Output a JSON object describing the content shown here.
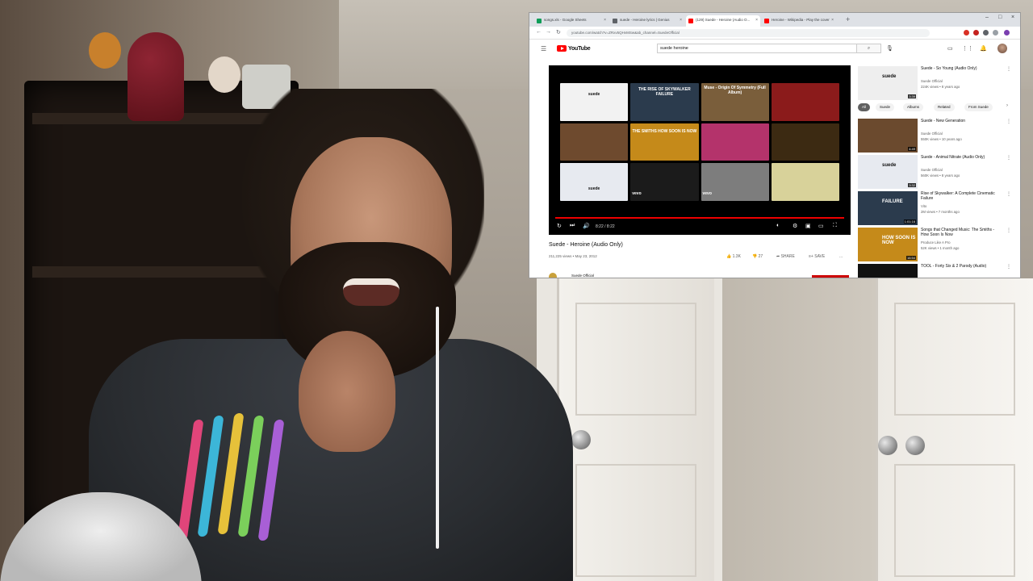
{
  "browser": {
    "tabs": [
      {
        "label": "songs.xls - Google Sheets",
        "color": "#0f9d58"
      },
      {
        "label": "suede - Heroine lyrics | Genius",
        "color": "#5f6368"
      },
      {
        "label": "(129) Suede - Heroine (Audio O...",
        "color": "#ff0000"
      },
      {
        "label": "Heroine - Wikipedia - Play the cover",
        "color": "#ff0000"
      }
    ],
    "new_tab": "+",
    "url": "youtube.com/watch?v=ZRxv5QHvMSw&ab_channel=SuedeOfficial"
  },
  "youtube": {
    "logo": "YouTube",
    "search_query": "suede heroine",
    "player": {
      "time": "8:22 / 8:22",
      "tiles": [
        {
          "text": "suede",
          "bg": "#f2f2f2",
          "fg": "#111"
        },
        {
          "text": "THE RISE OF SKYWALKER FAILURE",
          "bg": "#2b3b4d",
          "fg": "#fff"
        },
        {
          "text": "Muse - Origin Of Symmetry (Full Album)",
          "bg": "#7a5e3b",
          "fg": "#fff"
        },
        {
          "text": "",
          "bg": "#8b1b1b",
          "fg": "#fff"
        },
        {
          "text": "",
          "bg": "#6e4a2e",
          "fg": "#fff"
        },
        {
          "text": "THE SMITHS HOW SOON IS NOW",
          "bg": "#c58a1a",
          "fg": "#fff"
        },
        {
          "text": "",
          "bg": "#b4336b",
          "fg": "#fff"
        },
        {
          "text": "",
          "bg": "#3c2a12",
          "fg": "#fff"
        },
        {
          "text": "suede",
          "bg": "#e7eaf0",
          "fg": "#111"
        },
        {
          "text": "vevo",
          "bg": "#1b1b1b",
          "fg": "#fff"
        },
        {
          "text": "vevo",
          "bg": "#7d7d7d",
          "fg": "#fff"
        },
        {
          "text": "",
          "bg": "#d8d29a",
          "fg": "#333"
        }
      ]
    },
    "video": {
      "title": "Suede - Heroine (Audio Only)",
      "meta": "211,225 views • May 23, 2012",
      "likes": "1.3K",
      "dislikes": "27",
      "share": "SHARE",
      "save": "SAVE",
      "more": "...",
      "channel": "Suede Official"
    },
    "chips": [
      "All",
      "Suede",
      "Albums",
      "Related",
      "From Suede"
    ],
    "recommendations": [
      {
        "title": "Suede - So Young (Audio Only)",
        "channel": "Suede Official",
        "stats": "224K views • 8 years ago",
        "duration": "3:39",
        "bg": "#eeeeee",
        "badge": "suede"
      },
      {
        "title": "Suede - New Generation",
        "channel": "Suede Official",
        "stats": "550K views • 10 years ago",
        "duration": "4:49",
        "bg": "#6b4a2e",
        "badge": ""
      },
      {
        "title": "Suede - Animal Nitrate (Audio Only)",
        "channel": "Suede Official",
        "stats": "560K views • 8 years ago",
        "duration": "3:32",
        "bg": "#e7eaf0",
        "badge": "suede"
      },
      {
        "title": "Rise of Skywalker: A Complete Cinematic Failure",
        "channel": "Vito",
        "stats": "2M views • 7 months ago",
        "duration": "1:01:16",
        "bg": "#2b3b4d",
        "badge": "FAILURE"
      },
      {
        "title": "Songs that Changed Music: The Smiths - How Soon Is Now",
        "channel": "Produce Like A Pro",
        "stats": "52K views • 1 month ago",
        "duration": "16:54",
        "bg": "#c58a1a",
        "badge": "HOW SOON IS NOW"
      },
      {
        "title": "TOOL - Forty Six & 2 Parody (Audio)",
        "channel": "",
        "stats": "",
        "duration": "",
        "bg": "#111111",
        "badge": ""
      }
    ]
  }
}
